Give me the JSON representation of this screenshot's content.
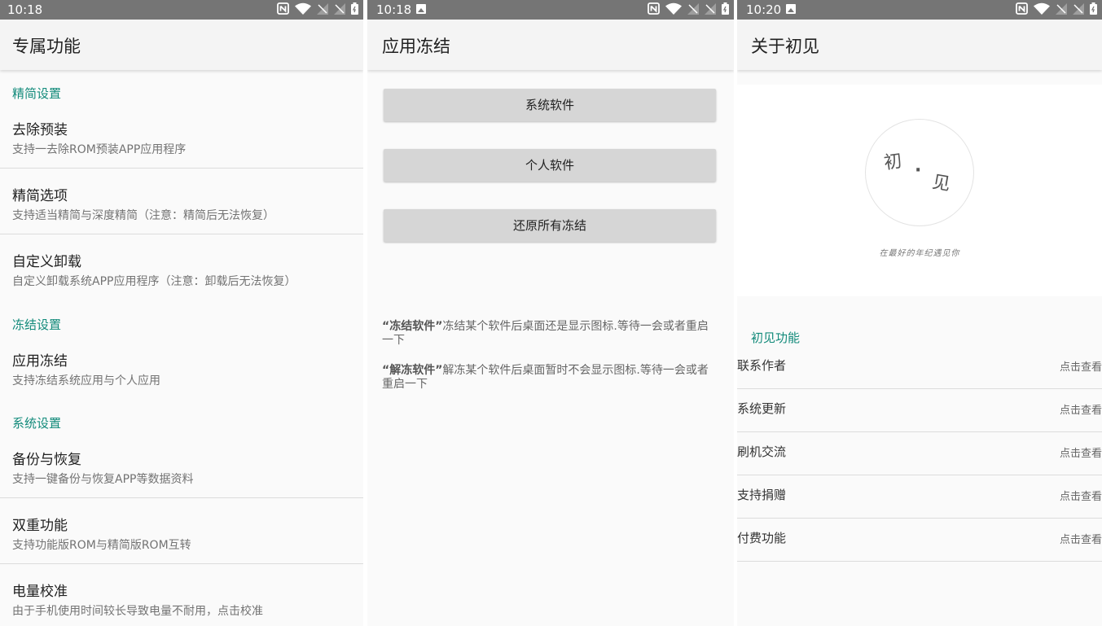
{
  "screens": [
    {
      "time": "10:18",
      "title": "专属功能",
      "sections": [
        {
          "header": "精简设置"
        },
        {
          "header": "冻结设置"
        },
        {
          "header": "系统设置"
        }
      ],
      "items": [
        {
          "title": "去除预装",
          "subtitle": "支持一去除ROM预装APP应用程序"
        },
        {
          "title": "精简选项",
          "subtitle": "支持适当精简与深度精简（注意：精简后无法恢复）"
        },
        {
          "title": "自定义卸载",
          "subtitle": "自定义卸载系统APP应用程序（注意：卸载后无法恢复）"
        },
        {
          "title": "应用冻结",
          "subtitle": "支持冻结系统应用与个人应用"
        },
        {
          "title": "备份与恢复",
          "subtitle": "支持一键备份与恢复APP等数据资料"
        },
        {
          "title": "双重功能",
          "subtitle": "支持功能版ROM与精简版ROM互转"
        },
        {
          "title": "电量校准",
          "subtitle": "由于手机使用时间较长导致电量不耐用，点击校准"
        }
      ]
    },
    {
      "time": "10:18",
      "title": "应用冻结",
      "buttons": [
        "系统软件",
        "个人软件",
        "还原所有冻结"
      ],
      "notes": [
        {
          "bold": "“冻结软件”",
          "text": "冻结某个软件后桌面还是显示图标.等待一会或者重启一下"
        },
        {
          "bold": "“解冻软件”",
          "text": "解冻某个软件后桌面暂时不会显示图标.等待一会或者重启一下"
        }
      ]
    },
    {
      "time": "10:20",
      "title": "关于初见",
      "logo": {
        "char1": "初",
        "dot": "·",
        "char2": "见",
        "tagline": "在最好的年纪遇见你"
      },
      "section": "初见功能",
      "rows": [
        {
          "label": "联系作者",
          "action": "点击查看"
        },
        {
          "label": "系统更新",
          "action": "点击查看"
        },
        {
          "label": "刷机交流",
          "action": "点击查看"
        },
        {
          "label": "支持捐赠",
          "action": "点击查看"
        },
        {
          "label": "付费功能",
          "action": "点击查看"
        }
      ]
    }
  ],
  "colors": {
    "accent": "#118a7a",
    "statusbar": "#757575",
    "appbar": "#f4f4f4",
    "button": "#d6d6d6"
  },
  "icons": [
    "image-icon",
    "nfc-icon",
    "wifi-icon",
    "signal-icon",
    "battery-icon"
  ]
}
